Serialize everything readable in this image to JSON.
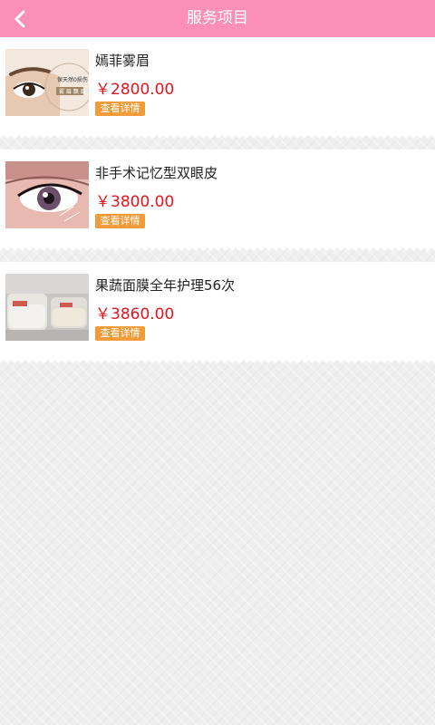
{
  "header": {
    "title": "服务项目",
    "back_icon": "chevron-left-icon"
  },
  "items": [
    {
      "name": "嫣菲雾眉",
      "price": "￥2800.00",
      "button": "查看详情",
      "thumb_text_1": "保天然0损伤",
      "thumb_text_2": "雾 眉 飘 眉"
    },
    {
      "name": "非手术记忆型双眼皮",
      "price": "￥3800.00",
      "button": "查看详情"
    },
    {
      "name": "果蔬面膜全年护理56次",
      "price": "￥3860.00",
      "button": "查看详情"
    }
  ]
}
